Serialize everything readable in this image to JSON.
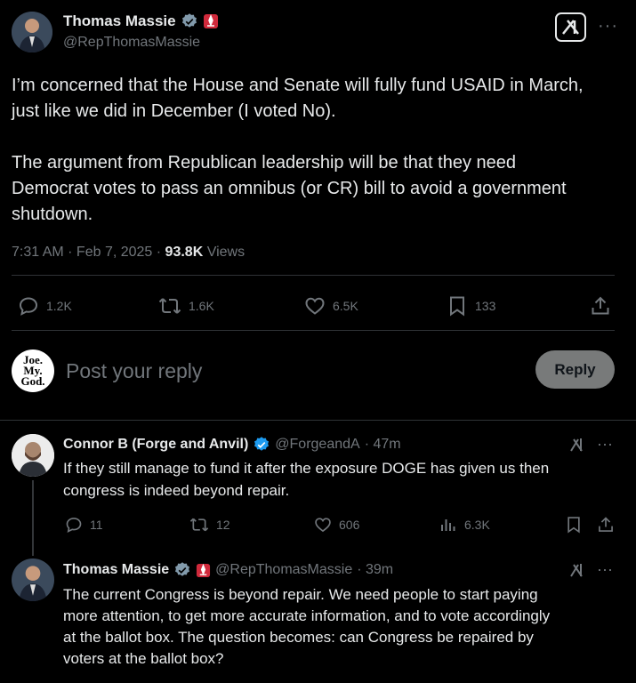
{
  "main_post": {
    "author_name": "Thomas Massie",
    "handle": "@RepThomasMassie",
    "text_line1": "I’m concerned that the House and Senate will fully fund USAID in March,",
    "text_line2": "just like we did in December (I voted No).",
    "text_line3": "The argument from Republican leadership will be that they need",
    "text_line4": "Democrat votes to pass an omnibus (or CR) bill to avoid a government",
    "text_line5": "shutdown.",
    "time": "7:31 AM · Feb 7, 2025 · ",
    "views_count": "93.8K",
    "views_label": " Views",
    "replies": "1.2K",
    "reposts": "1.6K",
    "likes": "6.5K",
    "bookmarks": "133"
  },
  "reply_box": {
    "avatar_text1": "Joe.",
    "avatar_text2": "My.",
    "avatar_text3": "God.",
    "placeholder": "Post your reply",
    "button": "Reply"
  },
  "replies": [
    {
      "author_name": "Connor B (Forge and Anvil)",
      "handle": "@ForgeandA",
      "time": "· 47m",
      "text_line1": "If they still manage to fund it after the exposure DOGE has given us then",
      "text_line2": "congress is indeed beyond repair.",
      "replies": "11",
      "reposts": "12",
      "likes": "606",
      "views": "6.3K"
    },
    {
      "author_name": "Thomas Massie",
      "handle": "@RepThomasMassie",
      "time": "· 39m",
      "text_line1": "The current Congress is beyond repair. We need people to start paying",
      "text_line2": "more attention, to get more accurate information, and to vote accordingly",
      "text_line3": "at the ballot box. The question becomes: can Congress be repaired by",
      "text_line4": "voters at the ballot box?"
    }
  ],
  "icons": {
    "verified_color": "#829aab",
    "verified_blue": "#1d9bf0",
    "flag_color": "#d0293b",
    "reply_button_bg": "#787a7a"
  }
}
